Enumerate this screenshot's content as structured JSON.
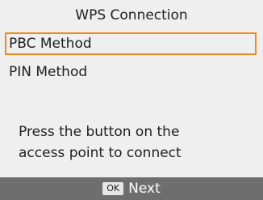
{
  "screen": {
    "title": "WPS Connection",
    "menu": [
      {
        "label": "PBC Method",
        "selected": true
      },
      {
        "label": "PIN Method",
        "selected": false
      }
    ],
    "message_line1": "Press the button on the",
    "message_line2": "access point to connect"
  },
  "footer": {
    "ok_key_label": "OK",
    "action_label": "Next"
  },
  "colors": {
    "background": "#efefef",
    "selection_border": "#f08a1c",
    "footer_bar": "#6e6e6e"
  }
}
